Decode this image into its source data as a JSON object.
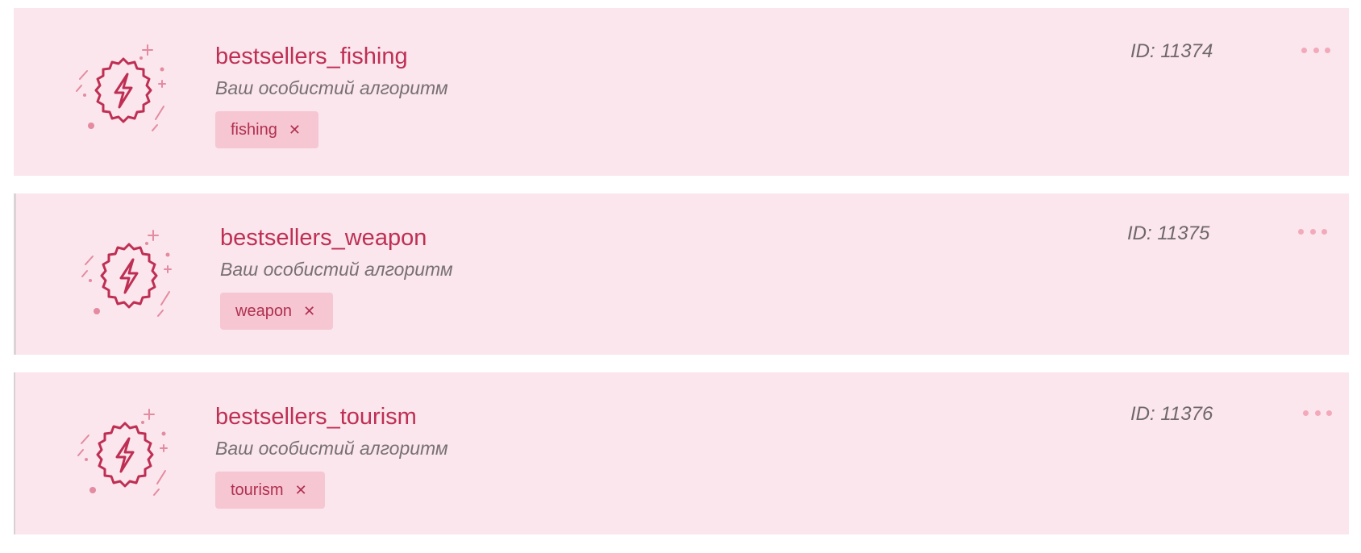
{
  "colors": {
    "card_background": "#fae6ec",
    "accent": "#bf2f54",
    "tag_background": "#f6c6d2",
    "menu_dots": "#f2a9bb"
  },
  "algorithms": [
    {
      "icon": "lightning-badge-icon",
      "title": "bestsellers_fishing",
      "subtitle": "Ваш особистий алгоритм",
      "tag": "fishing",
      "id_label": "ID: 11374",
      "menu_icon": "more-dots-icon"
    },
    {
      "icon": "lightning-badge-icon",
      "title": "bestsellers_weapon",
      "subtitle": "Ваш особистий алгоритм",
      "tag": "weapon",
      "id_label": "ID: 11375",
      "menu_icon": "more-dots-icon"
    },
    {
      "icon": "lightning-badge-icon",
      "title": "bestsellers_tourism",
      "subtitle": "Ваш особистий алгоритм",
      "tag": "tourism",
      "id_label": "ID: 11376",
      "menu_icon": "more-dots-icon"
    }
  ],
  "tag_remove_glyph": "✕"
}
